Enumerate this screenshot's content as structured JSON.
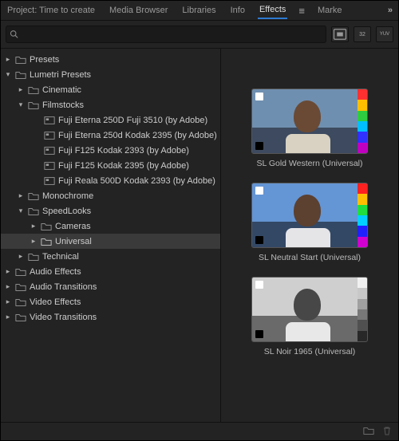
{
  "tabs": {
    "project": "Project: Time to create",
    "media": "Media Browser",
    "libraries": "Libraries",
    "info": "Info",
    "effects": "Effects",
    "markers": "Marke"
  },
  "search": {
    "placeholder": ""
  },
  "tree": {
    "presets": "Presets",
    "lumetri": "Lumetri Presets",
    "cinematic": "Cinematic",
    "filmstocks": "Filmstocks",
    "f1": "Fuji Eterna 250D Fuji 3510 (by Adobe)",
    "f2": "Fuji Eterna 250d Kodak 2395 (by Adobe)",
    "f3": "Fuji F125 Kodak 2393 (by Adobe)",
    "f4": "Fuji F125 Kodak 2395 (by Adobe)",
    "f5": "Fuji Reala 500D Kodak 2393 (by Adobe)",
    "monochrome": "Monochrome",
    "speedlooks": "SpeedLooks",
    "cameras": "Cameras",
    "universal": "Universal",
    "technical": "Technical",
    "audioeffects": "Audio Effects",
    "audiotrans": "Audio Transitions",
    "videoeffects": "Video Effects",
    "videotrans": "Video Transitions"
  },
  "previews": {
    "p1": "SL Gold Western (Universal)",
    "p2": "SL Neutral Start (Universal)",
    "p3": "SL Noir 1965 (Universal)"
  },
  "colors": {
    "p1": {
      "sky": "#6f8fb0",
      "ground": "#3d4a5f",
      "skin": "#6a4a34",
      "collar": "#d9d2c2",
      "bars": [
        "#ff3030",
        "#ffbf00",
        "#2ecc40",
        "#00bfff",
        "#3030ff",
        "#c000c0"
      ]
    },
    "p2": {
      "sky": "#6495d4",
      "ground": "#334865",
      "skin": "#5c4030",
      "collar": "#e5e5e8",
      "bars": [
        "#ff2020",
        "#ffbf00",
        "#20dd40",
        "#00cfff",
        "#2020ff",
        "#d000d0"
      ]
    },
    "p3": {
      "sky": "#cfcfcf",
      "ground": "#6a6a6a",
      "skin": "#474747",
      "collar": "#e8e8e8",
      "bars": [
        "#f0f0f0",
        "#c8c8c8",
        "#a0a0a0",
        "#787878",
        "#505050",
        "#282828"
      ]
    }
  },
  "toolbar_icons": {
    "a": "📋",
    "b": "32",
    "c": "YUV"
  }
}
